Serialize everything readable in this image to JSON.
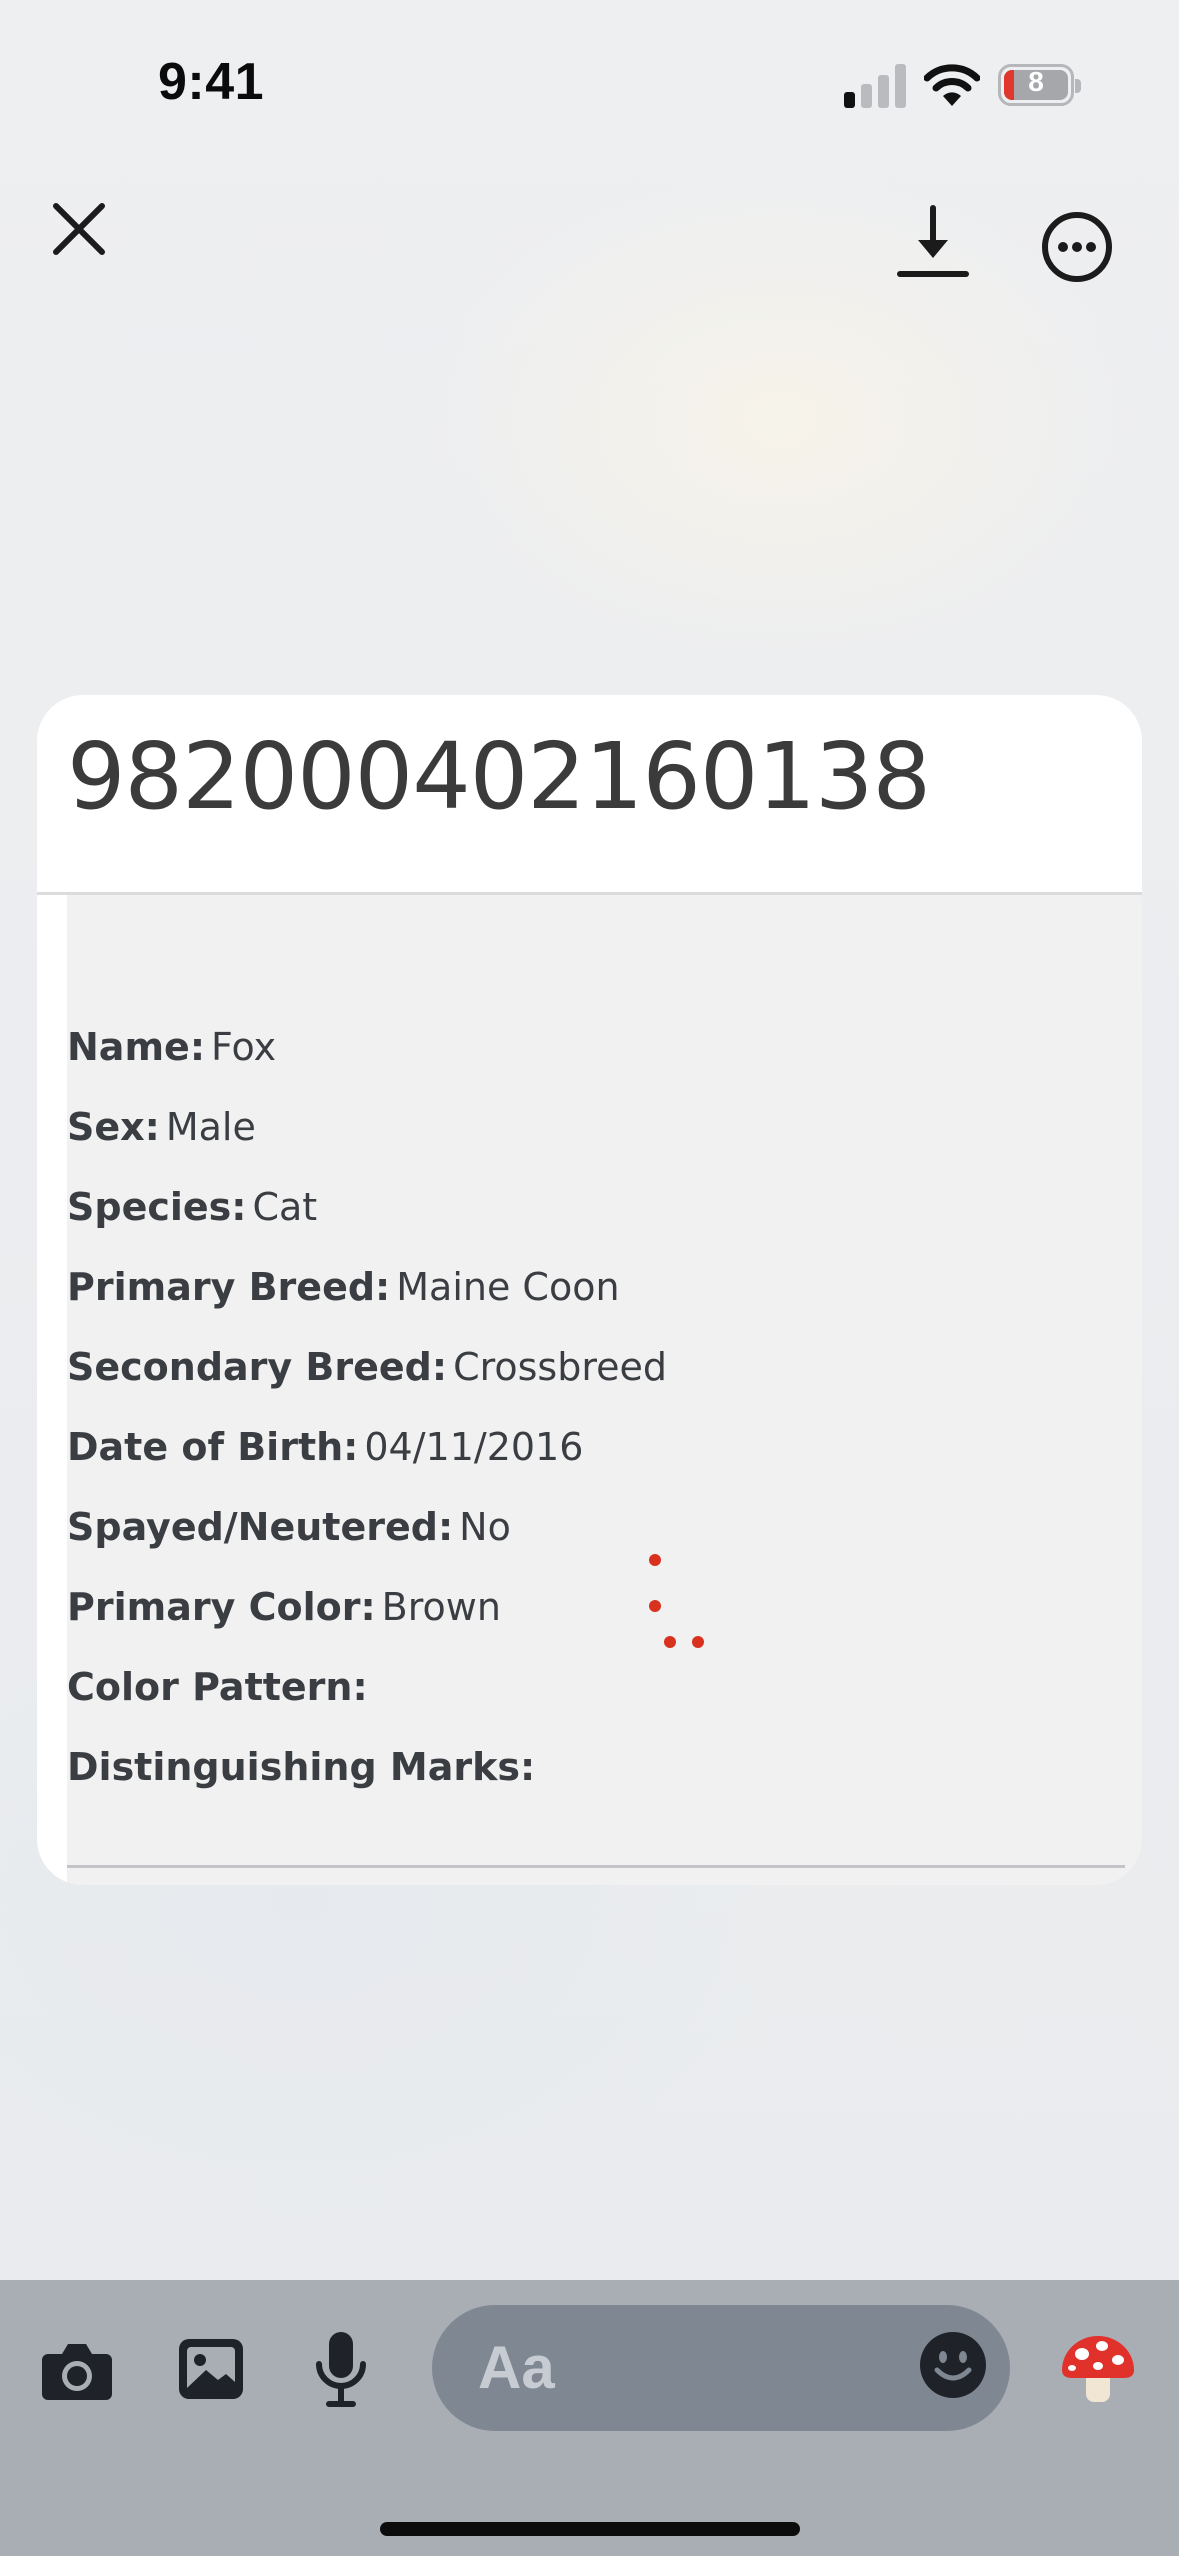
{
  "status_bar": {
    "time": "9:41",
    "battery_level": "8",
    "signal_bars_active": 1,
    "signal_bars_total": 4
  },
  "toolbar": {
    "close_icon": "close-icon",
    "download_icon": "download-icon",
    "more_icon": "more-options-icon"
  },
  "record": {
    "chip_number": "982000402160138",
    "fields": [
      {
        "label": "Name:",
        "value": "Fox"
      },
      {
        "label": "Sex:",
        "value": "Male"
      },
      {
        "label": "Species:",
        "value": "Cat"
      },
      {
        "label": "Primary Breed:",
        "value": "Maine Coon"
      },
      {
        "label": "Secondary Breed:",
        "value": "Crossbreed"
      },
      {
        "label": "Date of Birth:",
        "value": "04/11/2016"
      },
      {
        "label": "Spayed/Neutered:",
        "value": "No"
      },
      {
        "label": "Primary Color:",
        "value": "Brown"
      },
      {
        "label": "Color Pattern:",
        "value": ""
      },
      {
        "label": "Distinguishing Marks:",
        "value": ""
      }
    ]
  },
  "composer": {
    "placeholder": "Aa",
    "camera_icon": "camera-icon",
    "gallery_icon": "photo-gallery-icon",
    "mic_icon": "microphone-icon",
    "emoji_icon": "emoji-icon",
    "sticker": "🍄"
  },
  "colors": {
    "composer_bg": "#a9aeb5",
    "input_bg": "#7f8792",
    "text_dark": "#3a3d42",
    "battery_low": "#e0362b"
  }
}
